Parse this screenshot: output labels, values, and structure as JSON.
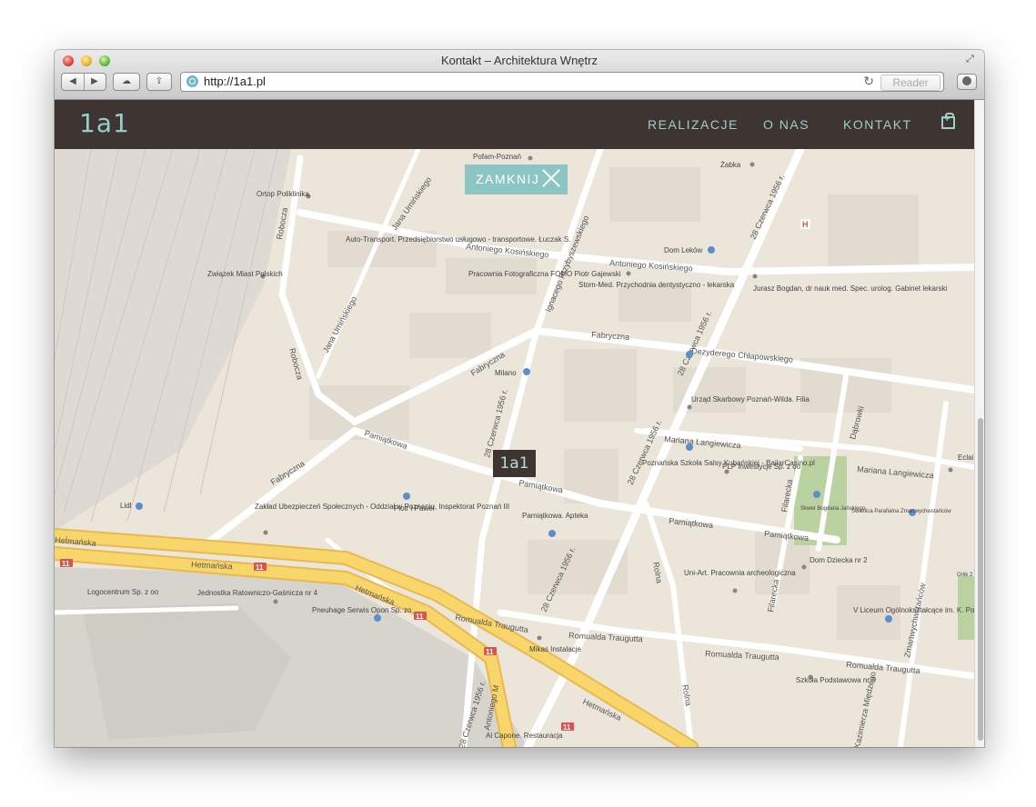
{
  "window": {
    "title": "Kontakt – Architektura Wnętrz"
  },
  "toolbar": {
    "url": "http://1a1.pl",
    "reader_label": "Reader"
  },
  "site": {
    "logo": "1a1",
    "nav": [
      "REALIZACJE",
      "O NAS",
      "KONTAKT"
    ],
    "close_label": "ZAMKNIJ",
    "marker_logo": "1a1"
  },
  "map": {
    "streets": [
      "Antoniego Kosińskiego",
      "Antoniego Kosińskiego",
      "Fabryczna",
      "Fabryczna",
      "Fabryczna",
      "Dezyderego Chłapowskiego",
      "Pamiątkowa",
      "Pamiątkowa",
      "Pamiątkowa",
      "Pamiątkowa",
      "Mariana Langiewicza",
      "Mariana Langiewicza",
      "Het́mańska",
      "Hetmańska",
      "Hetmańska",
      "Hetmańska",
      "Romualda Traugutta",
      "Romualda Traugutta",
      "Romualda Traugutta",
      "Romualda Traugutta",
      "Robocza",
      "Robocza",
      "Jana Umińskiego",
      "Jana Umińskiego",
      "Ignacego Przybyszewskiego",
      "28 Czerwca 1956 r.",
      "28 Czerwca 1956 r.",
      "28 Czerwca 1956 r.",
      "28 Czerwca 1956 r.",
      "28 Czerwca 1956 r.",
      "28 Czerwca 1956 r.",
      "Rolna",
      "Rolna",
      "Filarecka",
      "Filarecka",
      "Dąbrowki",
      "Zmartwychwstańców",
      "Kazimierza Międzego",
      "Antoniego M"
    ],
    "places": [
      {
        "name": "Pofam-Poznań"
      },
      {
        "name": "Ortop Poliklinika"
      },
      {
        "name": "Auto-Transport. Przedsiębiorstwo usługowo - transportowe. Łuczak S."
      },
      {
        "name": "Związek Miast Polskich"
      },
      {
        "name": "Pracownia Fotograficzna FOMO Piotr Gajewski"
      },
      {
        "name": "Stom-Med. Przychodnia dentystyczno - lekarska"
      },
      {
        "name": "Dom Leków"
      },
      {
        "name": "Żabka"
      },
      {
        "name": "Jurasz Bogdan, dr nauk med. Spec. urolog. Gabinet lekarski"
      },
      {
        "name": "Milano"
      },
      {
        "name": "Urząd Skarbowy Poznań-Wilda. Filia"
      },
      {
        "name": "Poznańska Szkoła Salsy Kubańskiej - BailarCasino.pl"
      },
      {
        "name": "PLP Inwestycje Sp. z oo"
      },
      {
        "name": "Skwer Bogdana Jańskiego"
      },
      {
        "name": "Świetlica Parafialna Zmartwychwstańców"
      },
      {
        "name": "Eclai Studi"
      },
      {
        "name": "Zakład Ubezpieczeń Społecznych - Oddział w Poznaniu, Inspektorat Poznań III"
      },
      {
        "name": "Lidl"
      },
      {
        "name": "Piotr i Paweł"
      },
      {
        "name": "Pamiątkowa. Apteka"
      },
      {
        "name": "Dom Dziecka nr 2"
      },
      {
        "name": "Uni-Art. Pracownia archeologiczna"
      },
      {
        "name": "Logocentrum Sp. z oo"
      },
      {
        "name": "Jednostka Ratowniczo-Gaśnicza nr 4"
      },
      {
        "name": "Pneuhage Serwis Opon Sp. zo"
      },
      {
        "name": "Mikas Instalacje"
      },
      {
        "name": "V Liceum Ogólnokształcące im. K. Potockiej"
      },
      {
        "name": "Szkoła Podstawowa nr 5"
      },
      {
        "name": "Al Capone. Restauracja"
      },
      {
        "name": "Orlik 2"
      }
    ],
    "route_badge": "11",
    "hospital_badge": "H"
  }
}
